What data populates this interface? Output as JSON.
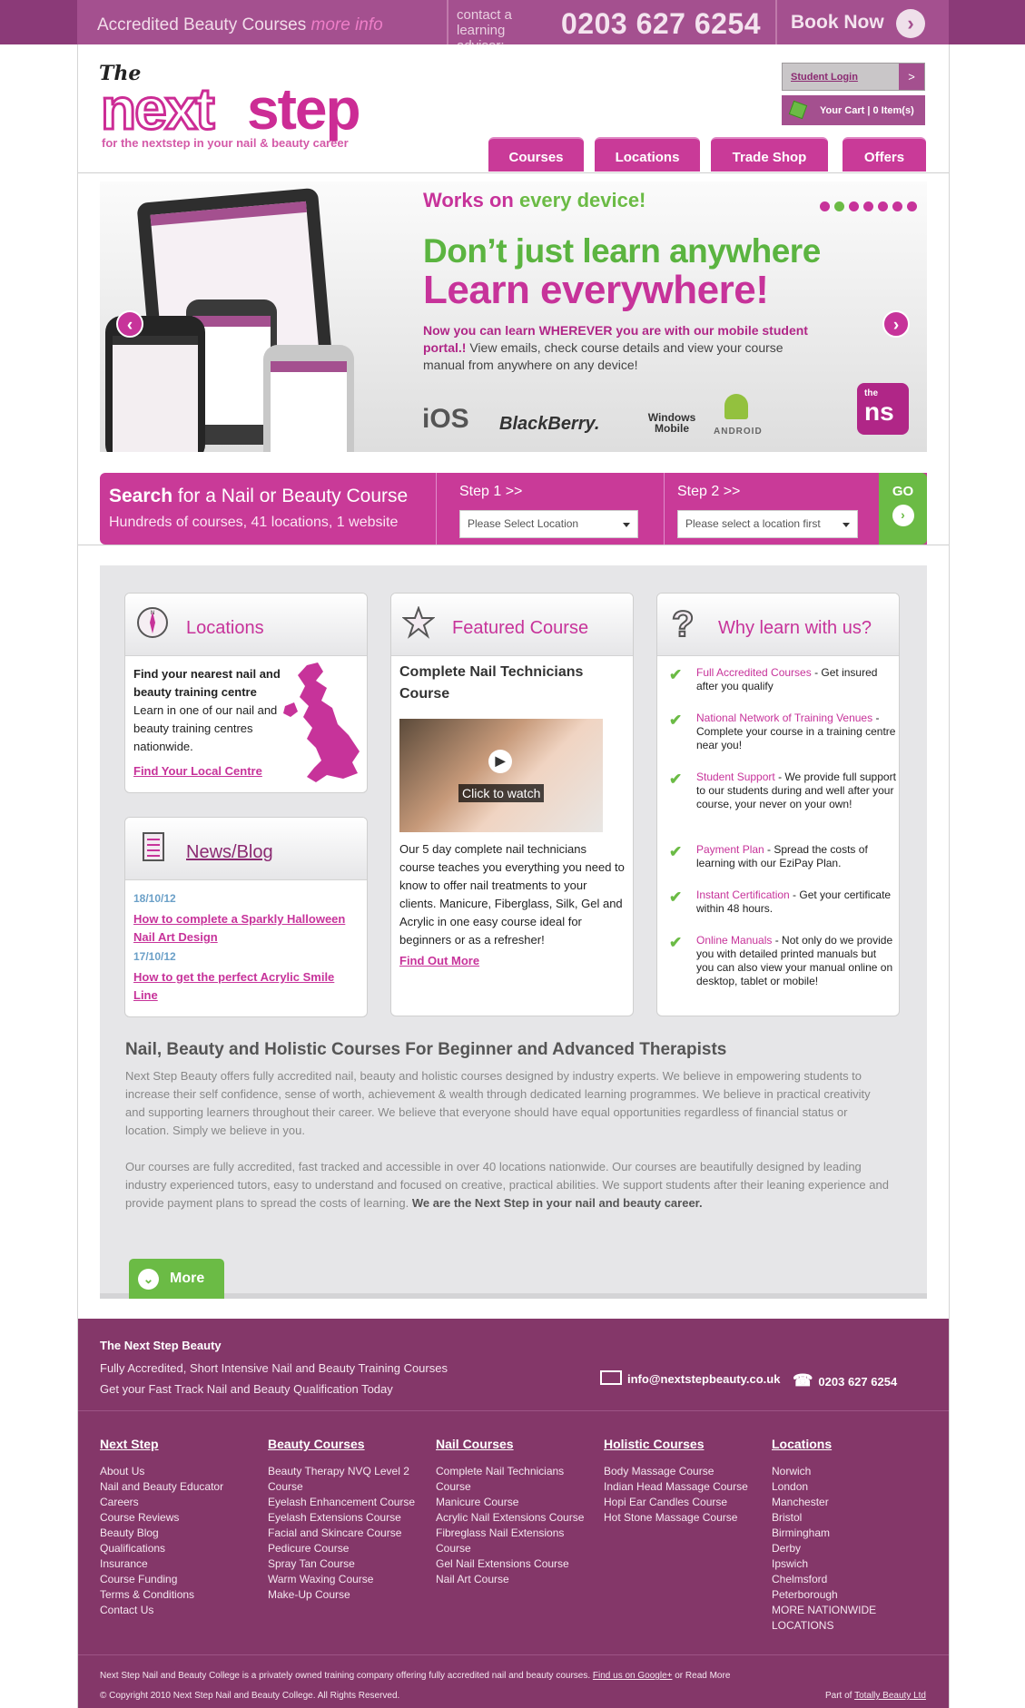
{
  "topbar": {
    "accredited": "Accredited Beauty Courses",
    "more_info": "more info",
    "contact_label": "contact a learning advisor:",
    "phone": "0203 627 6254",
    "book_now": "Book Now"
  },
  "header": {
    "logo_the": "The",
    "logo_next": "next",
    "logo_step": "step",
    "tagline": "for the nextstep in your nail & beauty career",
    "student_login": "Student Login",
    "login_arrow": ">",
    "cart": "Your Cart | 0 Item(s)"
  },
  "nav": [
    {
      "label": "Courses"
    },
    {
      "label": "Locations"
    },
    {
      "label": "Trade Shop"
    },
    {
      "label": "Offers"
    }
  ],
  "banner": {
    "works": "Works on",
    "every_device": "every device!",
    "headline1": "Don’t just learn anywhere",
    "headline2": "Learn everywhere!",
    "body_bold": "Now you can learn WHEREVER you are with our mobile student portal.!",
    "body": "View emails, check course details and view your course manual from anywhere on any device!",
    "platforms": [
      "iOS",
      "BlackBerry.",
      "Windows Mobile",
      "ANDROID"
    ],
    "badge_top": "the",
    "badge_main": "ns",
    "slide_count": 7,
    "active_slide": 2
  },
  "search": {
    "title_bold": "Search",
    "title_rest": "for a Nail or Beauty Course",
    "subtitle": "Hundreds of courses, 41 locations, 1 website",
    "step1": "Step 1 >>",
    "step1_placeholder": "Please Select Location",
    "step2": "Step 2 >>",
    "step2_placeholder": "Please select a location first",
    "go": "GO"
  },
  "locations_box": {
    "title": "Locations",
    "heading": "Find your nearest nail and beauty training centre",
    "body": "Learn in one of our nail and beauty training centres nationwide.",
    "link": "Find Your Local Centre"
  },
  "news_box": {
    "title": "News/Blog",
    "items": [
      {
        "date": "18/10/12",
        "title": "How to complete a Sparkly Halloween Nail Art Design"
      },
      {
        "date": "17/10/12",
        "title": "How to get the perfect Acrylic Smile Line"
      }
    ]
  },
  "featured_box": {
    "title": "Featured Course",
    "course": "Complete Nail Technicians Course",
    "video_caption": "Click to watch",
    "body": "Our 5 day complete nail technicians course teaches you everything you need to know to offer nail treatments to your clients. Manicure, Fiberglass, Silk, Gel and Acrylic in one easy course ideal for beginners or as a refresher!",
    "link": "Find Out More"
  },
  "why_box": {
    "title": "Why learn with us?",
    "items": [
      {
        "title": "Full Accredited Courses",
        "text": " - Get insured after you qualify"
      },
      {
        "title": "National Network of Training Venues",
        "text": " - Complete your course in a training centre near you!"
      },
      {
        "title": "Student Support",
        "text": " - We provide full support to our students during and well after your course, your never on your own!"
      },
      {
        "title": "Payment Plan",
        "text": " - Spread the costs of learning with our EziPay Plan."
      },
      {
        "title": "Instant Certification",
        "text": " - Get your certificate within 48 hours."
      },
      {
        "title": "Online Manuals",
        "text": " - Not only do we provide you with detailed printed manuals but you can also view your manual online on desktop, tablet or mobile!"
      }
    ]
  },
  "article": {
    "title": "Nail, Beauty and Holistic Courses For Beginner and Advanced Therapists",
    "p1": "Next Step Beauty offers fully accredited nail, beauty and holistic courses designed by industry experts. We believe in empowering students to increase their self confidence, sense of worth, achievement & wealth through dedicated learning programmes. We believe in practical creativity and supporting learners throughout their career. We believe that everyone should have equal opportunities regardless of financial status or location. Simply we believe in you.",
    "p2": "Our courses are fully accredited, fast tracked and accessible in over 40 locations nationwide. Our courses are beautifully designed by leading industry experienced tutors, easy to understand and focused on creative, practical abilities. We support students after their leaning experience and provide payment plans to spread the costs of learning.",
    "p2_bold": "We are the Next Step in your nail and beauty career.",
    "more": "More"
  },
  "footer": {
    "company": "The Next Step Beauty",
    "line1": "Fully Accredited, Short Intensive Nail and Beauty Training Courses",
    "line2": "Get your Fast Track Nail and Beauty Qualification Today",
    "email": "info@nextstepbeauty.co.uk",
    "phone": "0203 627 6254",
    "columns": [
      {
        "heading": "Next Step",
        "items": [
          "About Us",
          "Nail and Beauty Educator",
          "Careers",
          "Course Reviews",
          "Beauty Blog",
          "Qualifications",
          "Insurance",
          "Course Funding",
          "Terms & Conditions",
          "Contact Us"
        ]
      },
      {
        "heading": "Beauty Courses",
        "items": [
          "Beauty Therapy NVQ Level 2 Course",
          "Eyelash Enhancement Course",
          "Eyelash Extensions Course",
          "Facial and Skincare Course",
          "Pedicure Course",
          "Spray Tan Course",
          "Warm Waxing Course",
          "Make-Up Course"
        ]
      },
      {
        "heading": "Nail Courses",
        "items": [
          "Complete Nail Technicians Course",
          "Manicure Course",
          "Acrylic Nail Extensions Course",
          "Fibreglass Nail Extensions Course",
          "Gel Nail Extensions Course",
          "Nail Art Course"
        ]
      },
      {
        "heading": "Holistic Courses",
        "items": [
          "Body Massage Course",
          "Indian Head Massage Course",
          "Hopi Ear Candles Course",
          "Hot Stone Massage Course"
        ]
      },
      {
        "heading": "Locations",
        "items": [
          "Norwich",
          "London",
          "Manchester",
          "Bristol",
          "Birmingham",
          "Derby",
          "Ipswich",
          "Chelmsford",
          "Peterborough",
          "MORE NATIONWIDE LOCATIONS"
        ]
      }
    ],
    "about": "Next Step Nail and Beauty College is a privately owned training company offering fully accredited nail and beauty courses.",
    "google_link": "Find us on Google+",
    "read_more": "or Read More",
    "copyright": "© Copyright 2010 Next Step Nail and Beauty College. All Rights Reserved.",
    "part_of": "Part of",
    "part_of_link": "Totally Beauty Ltd"
  }
}
